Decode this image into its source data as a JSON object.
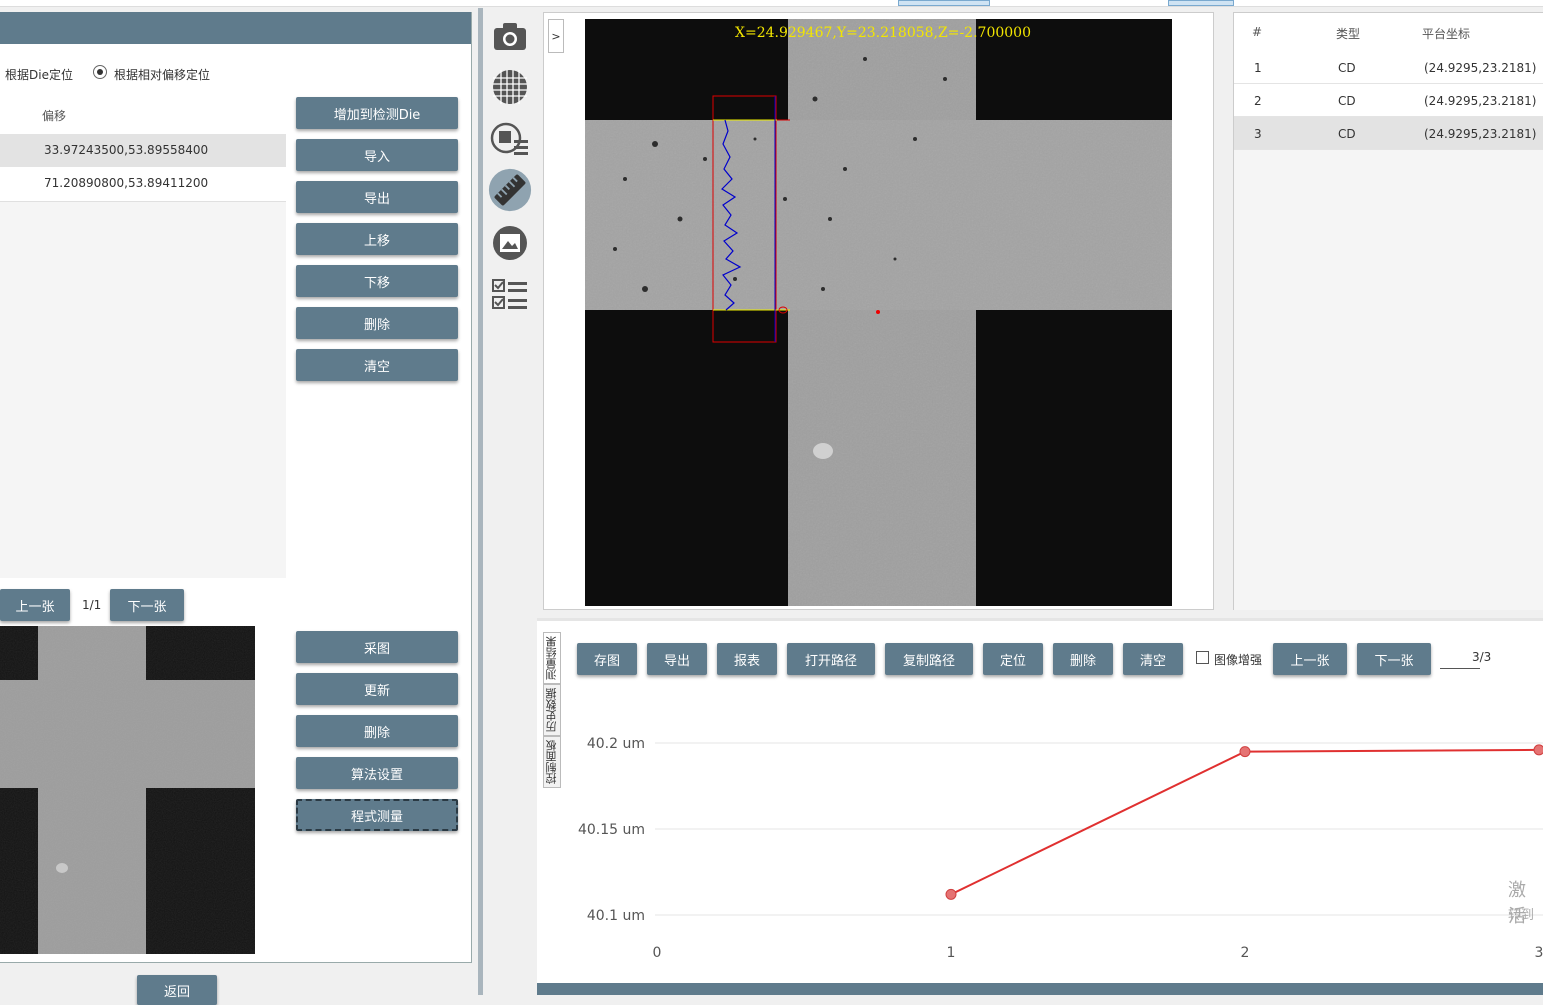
{
  "left_panel": {
    "radio_die": "根据Die定位",
    "radio_offset": "根据相对偏移定位",
    "table_header_offset": "偏移",
    "rows": [
      "33.97243500,53.89558400",
      "71.20890800,53.89411200"
    ],
    "buttons": {
      "add_die": "增加到检测Die",
      "import": "导入",
      "export": "导出",
      "move_up": "上移",
      "move_down": "下移",
      "delete": "删除",
      "clear": "清空"
    },
    "pager": {
      "prev": "上一张",
      "page": "1/1",
      "next": "下一张"
    },
    "image_buttons": {
      "capture": "采图",
      "update": "更新",
      "delete": "删除",
      "algo": "算法设置",
      "measure": "程式测量"
    },
    "back": "返回"
  },
  "viewer": {
    "expand": ">",
    "coord_text": "X=24.929467,Y=23.218058,Z=-2.700000"
  },
  "result_table": {
    "headers": [
      "#",
      "类型",
      "平台坐标"
    ],
    "rows": [
      {
        "idx": "1",
        "type": "CD",
        "coord": "(24.9295,23.2181)"
      },
      {
        "idx": "2",
        "type": "CD",
        "coord": "(24.9295,23.2181)"
      },
      {
        "idx": "3",
        "type": "CD",
        "coord": "(24.9295,23.2181)"
      }
    ]
  },
  "bottom": {
    "vertical_tabs": [
      "测量结果",
      "历史数据",
      "控制面板"
    ],
    "toolbar": {
      "save_img": "存图",
      "export": "导出",
      "report": "报表",
      "open_path": "打开路径",
      "copy_path": "复制路径",
      "locate": "定位",
      "delete": "删除",
      "clear": "清空",
      "enhance": "图像增强",
      "prev": "上一张",
      "next": "下一张",
      "page": "3/3"
    },
    "watermark": [
      "激活",
      "转到"
    ]
  },
  "chart_data": {
    "type": "line",
    "x": [
      1,
      2,
      3
    ],
    "y_ticks": [
      "40.2 um",
      "40.15 um",
      "40.1 um"
    ],
    "x_ticks": [
      "0",
      "1",
      "2",
      "3"
    ],
    "xlim": [
      0,
      3
    ],
    "ylim": [
      40.1,
      40.2
    ],
    "series": [
      {
        "values": [
          40.112,
          40.195,
          40.196
        ],
        "color": "#e03030"
      }
    ],
    "grid": true
  },
  "colors": {
    "accent": "#5f7b8c",
    "plot_line": "#e03030"
  }
}
